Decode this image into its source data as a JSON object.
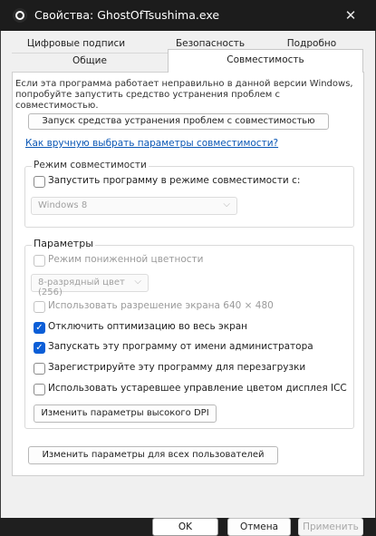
{
  "window": {
    "title": "Свойства: GhostOfTsushima.exe",
    "close_glyph": "✕",
    "app_icon": "app-icon"
  },
  "tabs": {
    "row1": [
      "Цифровые подписи",
      "Безопасность",
      "Подробно"
    ],
    "row2": [
      "Общие",
      "Совместимость"
    ],
    "active": "Совместимость"
  },
  "compat": {
    "intro": "Если эта программа работает неправильно в данной версии Windows, попробуйте запустить средство устранения проблем с совместимостью.",
    "troubleshooter_button": "Запуск средства устранения проблем с совместимостью",
    "manual_link": "Как вручную выбрать параметры совместимости?",
    "mode_group": {
      "label": "Режим совместимости",
      "checkbox_label": "Запустить программу в режиме совместимости с:",
      "checked": false,
      "os_select": "Windows 8"
    },
    "params_group": {
      "label": "Параметры",
      "reduced_color": {
        "label": "Режим пониженной цветности",
        "checked": false,
        "disabled": true
      },
      "color_select": "8-разрядный цвет (256)",
      "res_640": {
        "label": "Использовать разрешение экрана 640 × 480",
        "checked": false,
        "disabled": true
      },
      "disable_fullscreen_opt": {
        "label": "Отключить оптимизацию во весь экран",
        "checked": true
      },
      "run_as_admin": {
        "label": "Запускать эту программу от имени администратора",
        "checked": true
      },
      "register_restart": {
        "label": "Зарегистрируйте эту программу для перезагрузки",
        "checked": false
      },
      "legacy_icc": {
        "label": "Использовать устаревшее управление цветом дисплея ICC",
        "checked": false
      },
      "high_dpi_button": "Изменить параметры высокого DPI"
    },
    "all_users_button": "Изменить параметры для всех пользователей"
  },
  "footer": {
    "ok": "OK",
    "cancel": "Отмена",
    "apply": "Применить"
  },
  "colors": {
    "accent": "#0b5ed7",
    "link": "#0b57b5",
    "titlebar": "#1c1c1c"
  }
}
